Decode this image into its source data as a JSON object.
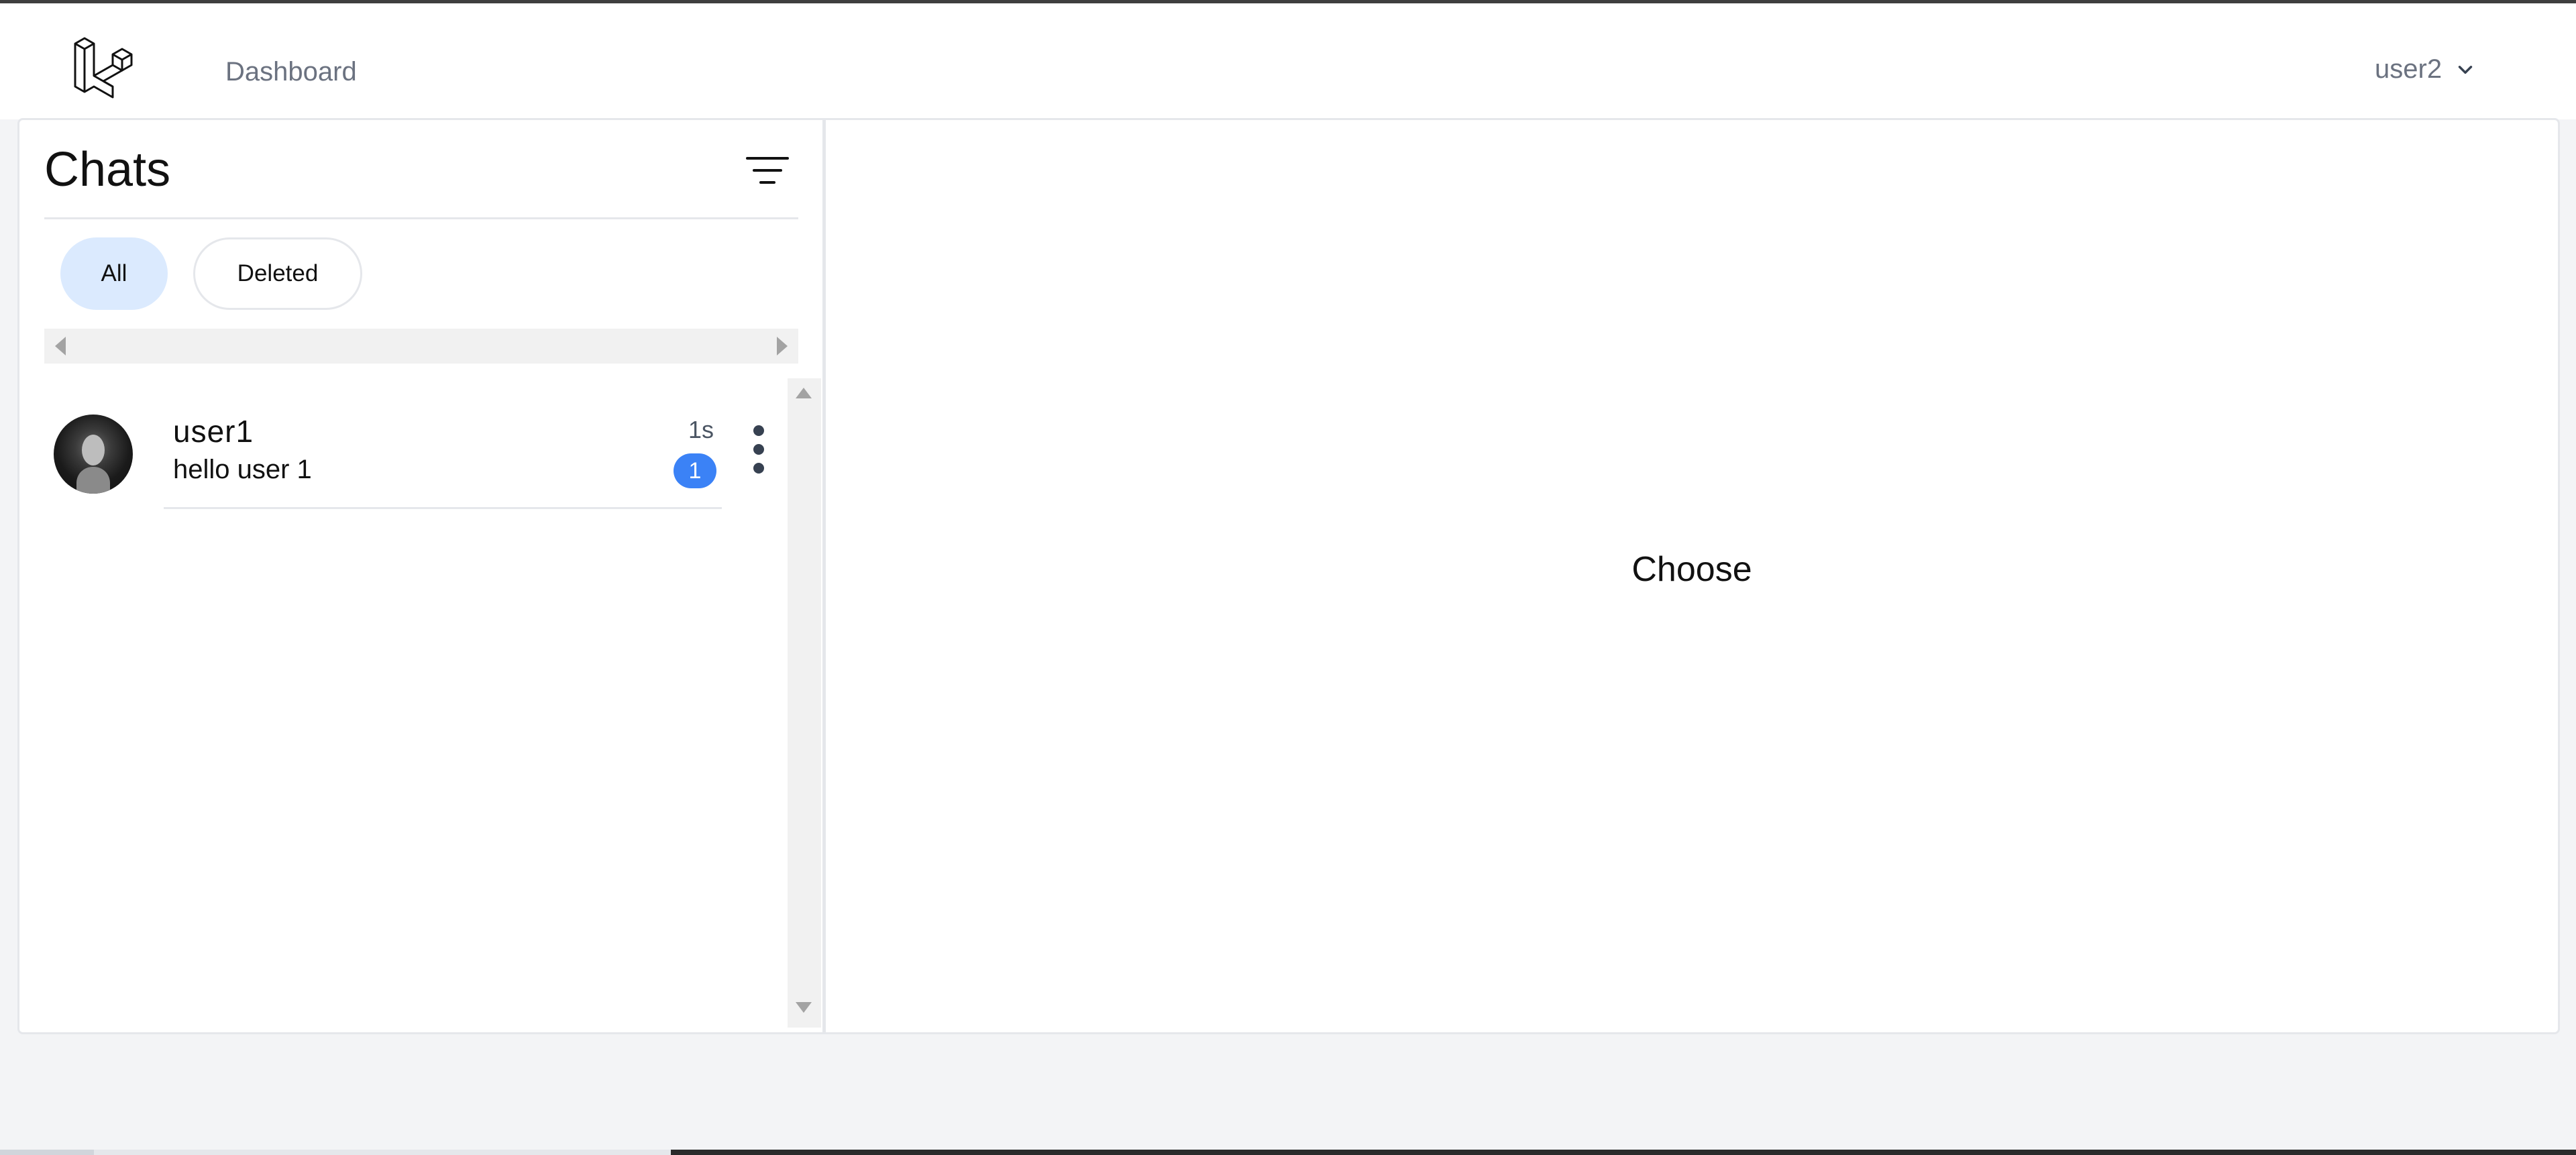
{
  "nav": {
    "logo_icon": "laravel-logo-icon",
    "dashboard_label": "Dashboard",
    "user_label": "user2",
    "user_menu_icon": "chevron-down-icon"
  },
  "sidebar": {
    "title": "Chats",
    "filter_icon": "filter-icon",
    "tabs": [
      {
        "label": "All",
        "active": true
      },
      {
        "label": "Deleted",
        "active": false
      }
    ],
    "chats": [
      {
        "name": "user1",
        "preview": "hello user 1",
        "time": "1s",
        "unread": "1",
        "avatar_icon": "avatar",
        "menu_icon": "more-vertical-icon"
      }
    ]
  },
  "main": {
    "placeholder": "Choose"
  },
  "colors": {
    "accent": "#3b82f6",
    "active_tab_bg": "#dbeafe",
    "page_bg": "#f3f4f6",
    "muted_text": "#6b7280"
  }
}
